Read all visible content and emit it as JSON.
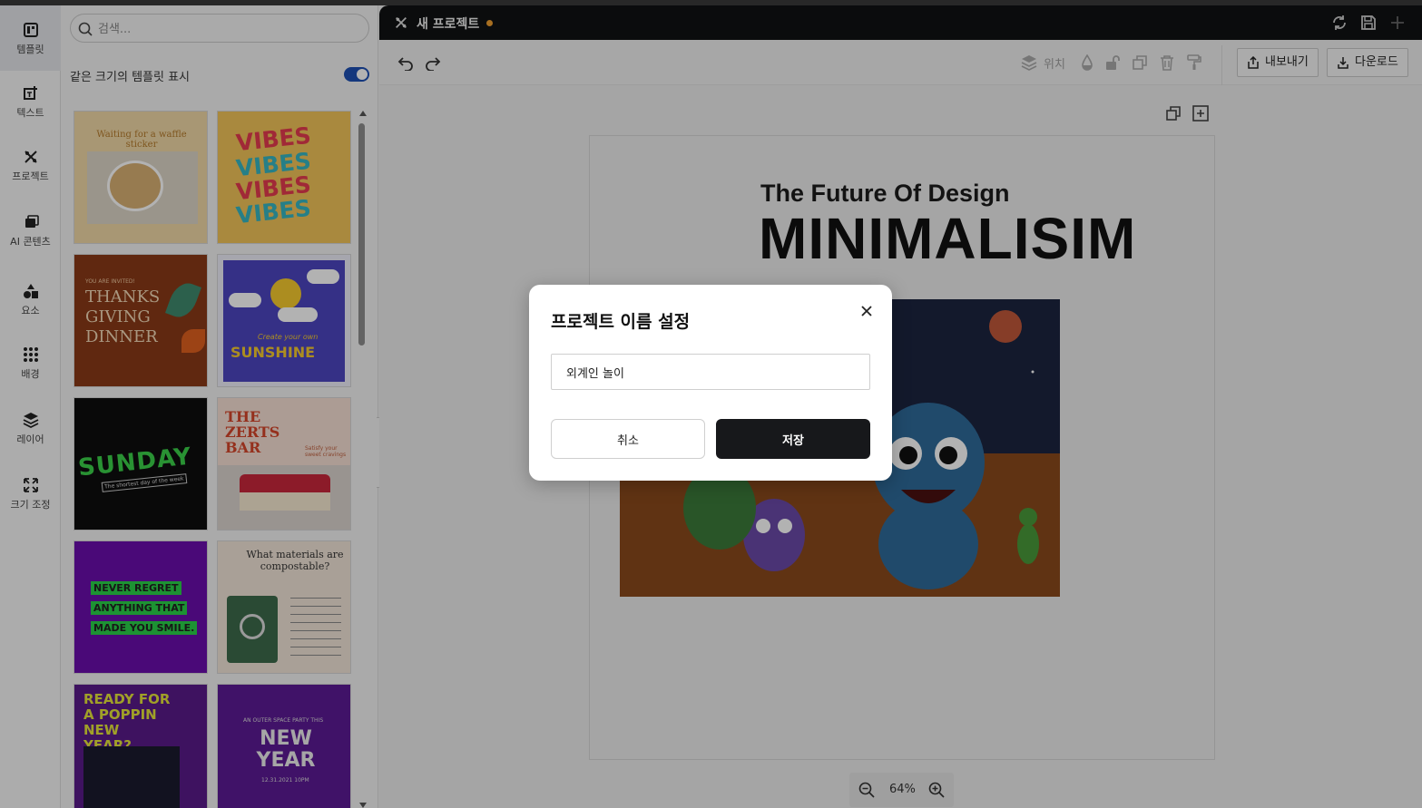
{
  "rail": {
    "items": [
      {
        "label": "템플릿",
        "icon": "template-icon"
      },
      {
        "label": "텍스트",
        "icon": "text-icon"
      },
      {
        "label": "프로젝트",
        "icon": "project-icon"
      },
      {
        "label": "AI 콘텐츠",
        "icon": "ai-content-icon"
      },
      {
        "label": "요소",
        "icon": "elements-icon"
      },
      {
        "label": "배경",
        "icon": "background-icon"
      },
      {
        "label": "레이어",
        "icon": "layers-icon"
      },
      {
        "label": "크기 조정",
        "icon": "resize-icon"
      }
    ]
  },
  "panel": {
    "search_placeholder": "검색...",
    "toggle_label": "같은 크기의 템플릿 표시",
    "toggle_on": true,
    "templates": [
      {
        "text": "Waiting for a waffle sticker"
      },
      {
        "text": "VIBES"
      },
      {
        "text": "YOU ARE INVITED!",
        "text2": "THANKS GIVING DINNER"
      },
      {
        "text": "Create your own",
        "text2": "SUNSHINE"
      },
      {
        "text": "SUNDAY",
        "text2": "The shortest day of the week"
      },
      {
        "text": "THE ZERTS BAR",
        "text2": "Satisfy your sweet cravings"
      },
      {
        "text": "NEVER REGRET",
        "text2": "ANYTHING THAT",
        "text3": "MADE YOU SMILE."
      },
      {
        "text": "What materials are compostable?"
      },
      {
        "text": "READY FOR A POPPIN NEW YEAR?"
      },
      {
        "text": "AN OUTER SPACE PARTY THIS",
        "text2": "NEW YEAR",
        "text3": "12.31.2021 10PM"
      }
    ]
  },
  "titlebar": {
    "title": "새 프로젝트",
    "unsaved_color": "#f0a030"
  },
  "toolbar": {
    "position_label": "위치",
    "export_label": "내보내기",
    "download_label": "다운로드"
  },
  "canvas": {
    "kicker": "The Future Of Design",
    "headline": "MINIMALISIM",
    "zoom": "64%"
  },
  "modal": {
    "title": "프로젝트 이름 설정",
    "input_value": "외계인 놀이",
    "cancel_label": "취소",
    "save_label": "저장"
  },
  "colors": {
    "accent": "#1d4fb3",
    "dark": "#111214",
    "save_bg": "#17181b"
  }
}
